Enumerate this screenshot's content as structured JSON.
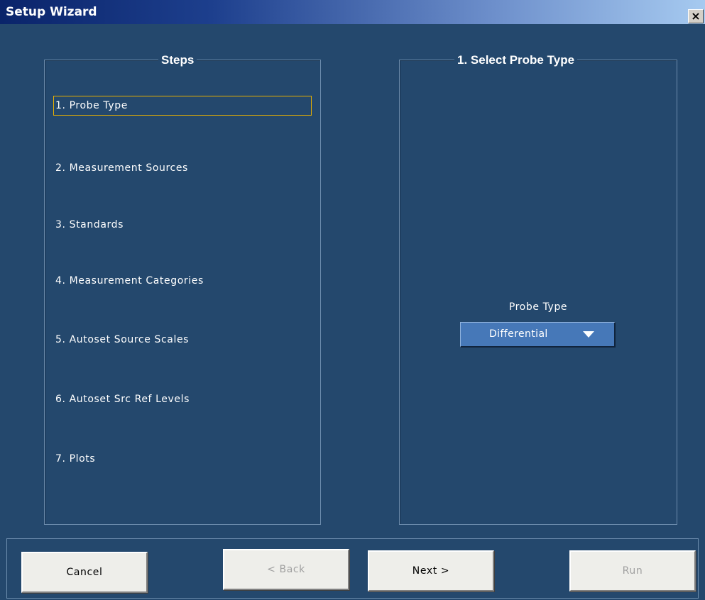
{
  "window": {
    "title": "Setup Wizard",
    "close_label": "×"
  },
  "steps_panel": {
    "legend": "Steps",
    "items": [
      {
        "label": "1. Probe Type",
        "active": true
      },
      {
        "label": "2. Measurement Sources",
        "active": false
      },
      {
        "label": "3. Standards",
        "active": false
      },
      {
        "label": "4. Measurement Categories",
        "active": false
      },
      {
        "label": "5. Autoset Source Scales",
        "active": false
      },
      {
        "label": "6. Autoset Src Ref Levels",
        "active": false
      },
      {
        "label": "7. Plots",
        "active": false
      }
    ]
  },
  "probe_panel": {
    "legend": "1. Select Probe Type",
    "field_label": "Probe Type",
    "selected_value": "Differential"
  },
  "buttons": {
    "cancel": {
      "label": "Cancel",
      "enabled": true
    },
    "back": {
      "label": "< Back",
      "enabled": false
    },
    "next": {
      "label": "Next >",
      "enabled": true
    },
    "run": {
      "label": "Run",
      "enabled": false
    }
  },
  "colors": {
    "panel_background": "#24486d",
    "active_step_border": "#e8b000",
    "dropdown_background": "#4678b8",
    "title_bar_start": "#0a246a"
  }
}
